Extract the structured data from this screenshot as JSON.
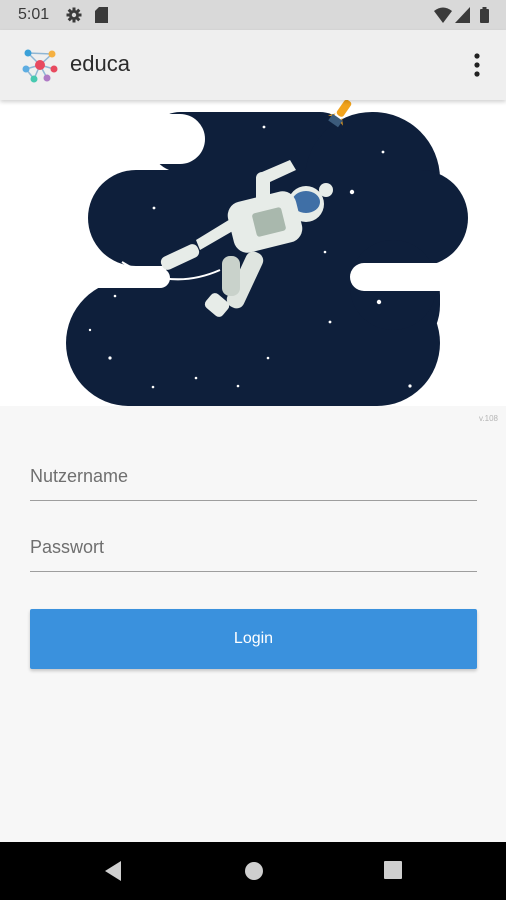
{
  "status_bar": {
    "time": "5:01",
    "left_icons": [
      "settings-icon",
      "sd-card-icon"
    ],
    "right_icons": [
      "wifi-icon",
      "signal-icon",
      "battery-icon"
    ]
  },
  "app_bar": {
    "title": "educa",
    "logo_icon": "educa-logo-icon",
    "menu_icon": "more-vert-icon"
  },
  "hero": {
    "illustration": "astronaut-space-illustration",
    "colors": {
      "space": "#0e1f3b",
      "rocket": "#f2a31c"
    }
  },
  "version": "v.108",
  "form": {
    "username_placeholder": "Nutzername",
    "password_placeholder": "Passwort",
    "login_label": "Login"
  },
  "colors": {
    "accent": "#3a91dd"
  },
  "nav_bar": {
    "icons": [
      "back-icon",
      "home-icon",
      "recents-icon"
    ]
  }
}
